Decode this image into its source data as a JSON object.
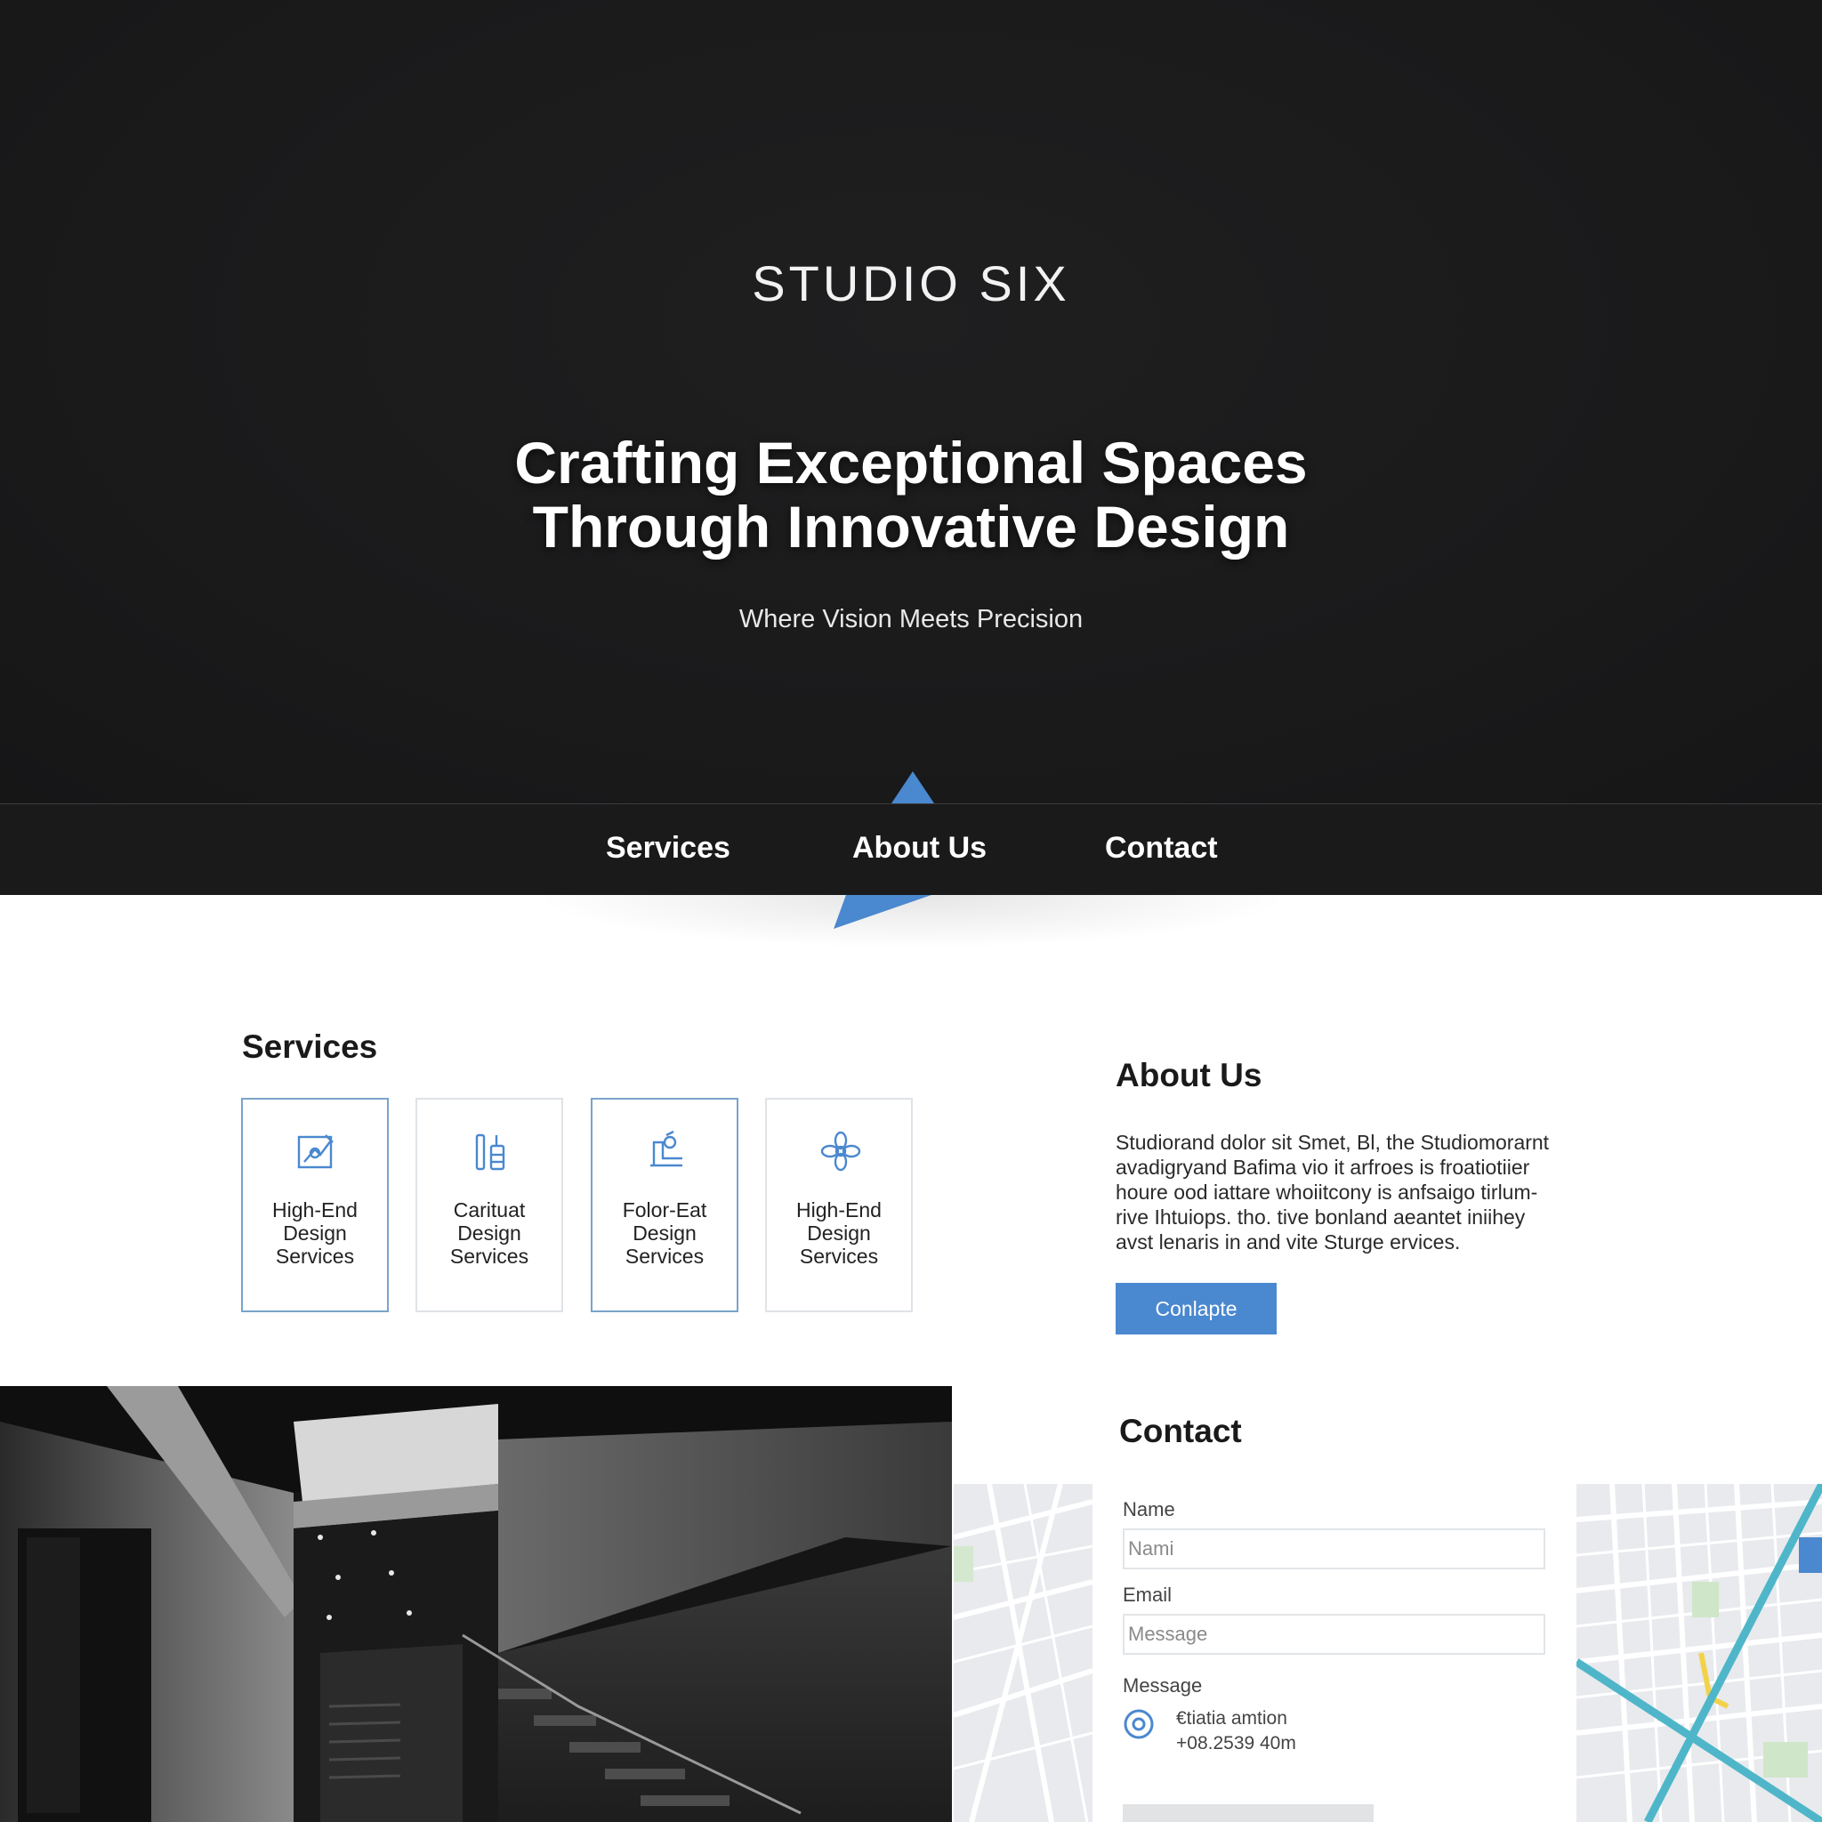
{
  "brand": "STUDIO SIX",
  "hero": {
    "headline_line1": "Crafting Exceptional Spaces",
    "headline_line2": "Through Innovative Design",
    "tagline": "Where Vision Meets Precision"
  },
  "nav": {
    "items": [
      {
        "label": "Services"
      },
      {
        "label": "About Us"
      },
      {
        "label": "Contact"
      }
    ]
  },
  "services": {
    "title": "Services",
    "cards": [
      {
        "line1": "High-End",
        "line2": "Design",
        "line3": "Services",
        "icon": "drafting-icon"
      },
      {
        "line1": "Carituat",
        "line2": "Design",
        "line3": "Services",
        "icon": "tools-icon"
      },
      {
        "line1": "Folor-Eat",
        "line2": "Design",
        "line3": "Services",
        "icon": "blueprint-icon"
      },
      {
        "line1": "High-End",
        "line2": "Design",
        "line3": "Services",
        "icon": "flower-icon"
      }
    ]
  },
  "about": {
    "title": "About Us",
    "line1": "Studiorand dolor sit Smet, Bl, the Studiomorarnt",
    "line2": "avadigryand Bafima vio it arfroes is froatiotiier",
    "line3": "houre ood iattare whoiitcony is anfsaigo tirlum-",
    "line4": "rive Ihtuiops. tho. tive bonland aeantet iniihey",
    "line5": "avst lenaris in and vite Sturge ervices.",
    "button": "Conlapte"
  },
  "contact": {
    "title": "Contact",
    "name_label": "Name",
    "name_placeholder": "Nami",
    "email_label": "Email",
    "email_placeholder": "Message",
    "message_label": "Message",
    "info_line1": "€tiatia amtion",
    "info_line2": "+08.2539 40m"
  },
  "colors": {
    "accent": "#4a88cf",
    "dark": "#1a1a1b",
    "map_route": "#4fb6c9"
  }
}
